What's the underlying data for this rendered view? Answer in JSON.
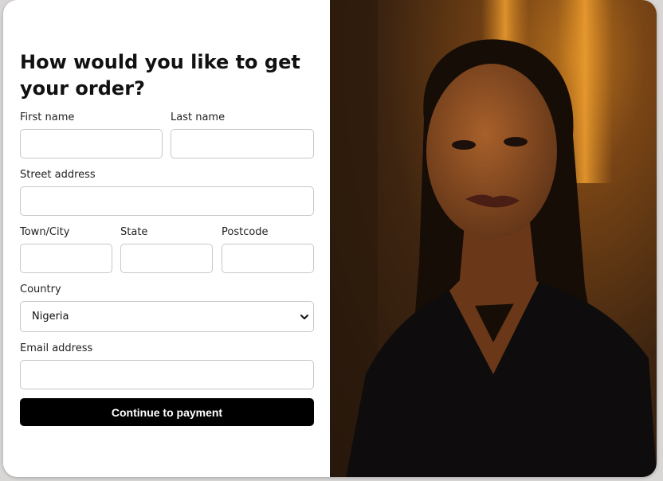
{
  "form": {
    "heading": "How would you like to get your order?",
    "first_name_label": "First name",
    "last_name_label": "Last name",
    "street_label": "Street address",
    "town_label": "Town/City",
    "state_label": "State",
    "postcode_label": "Postcode",
    "country_label": "Country",
    "country_value": "Nigeria",
    "email_label": "Email address",
    "submit_label": "Continue to payment"
  },
  "colors": {
    "button_bg": "#000000",
    "button_text": "#ffffff",
    "input_border": "#c8c8c8"
  },
  "icons": {
    "country_select": "chevron-down-icon"
  }
}
